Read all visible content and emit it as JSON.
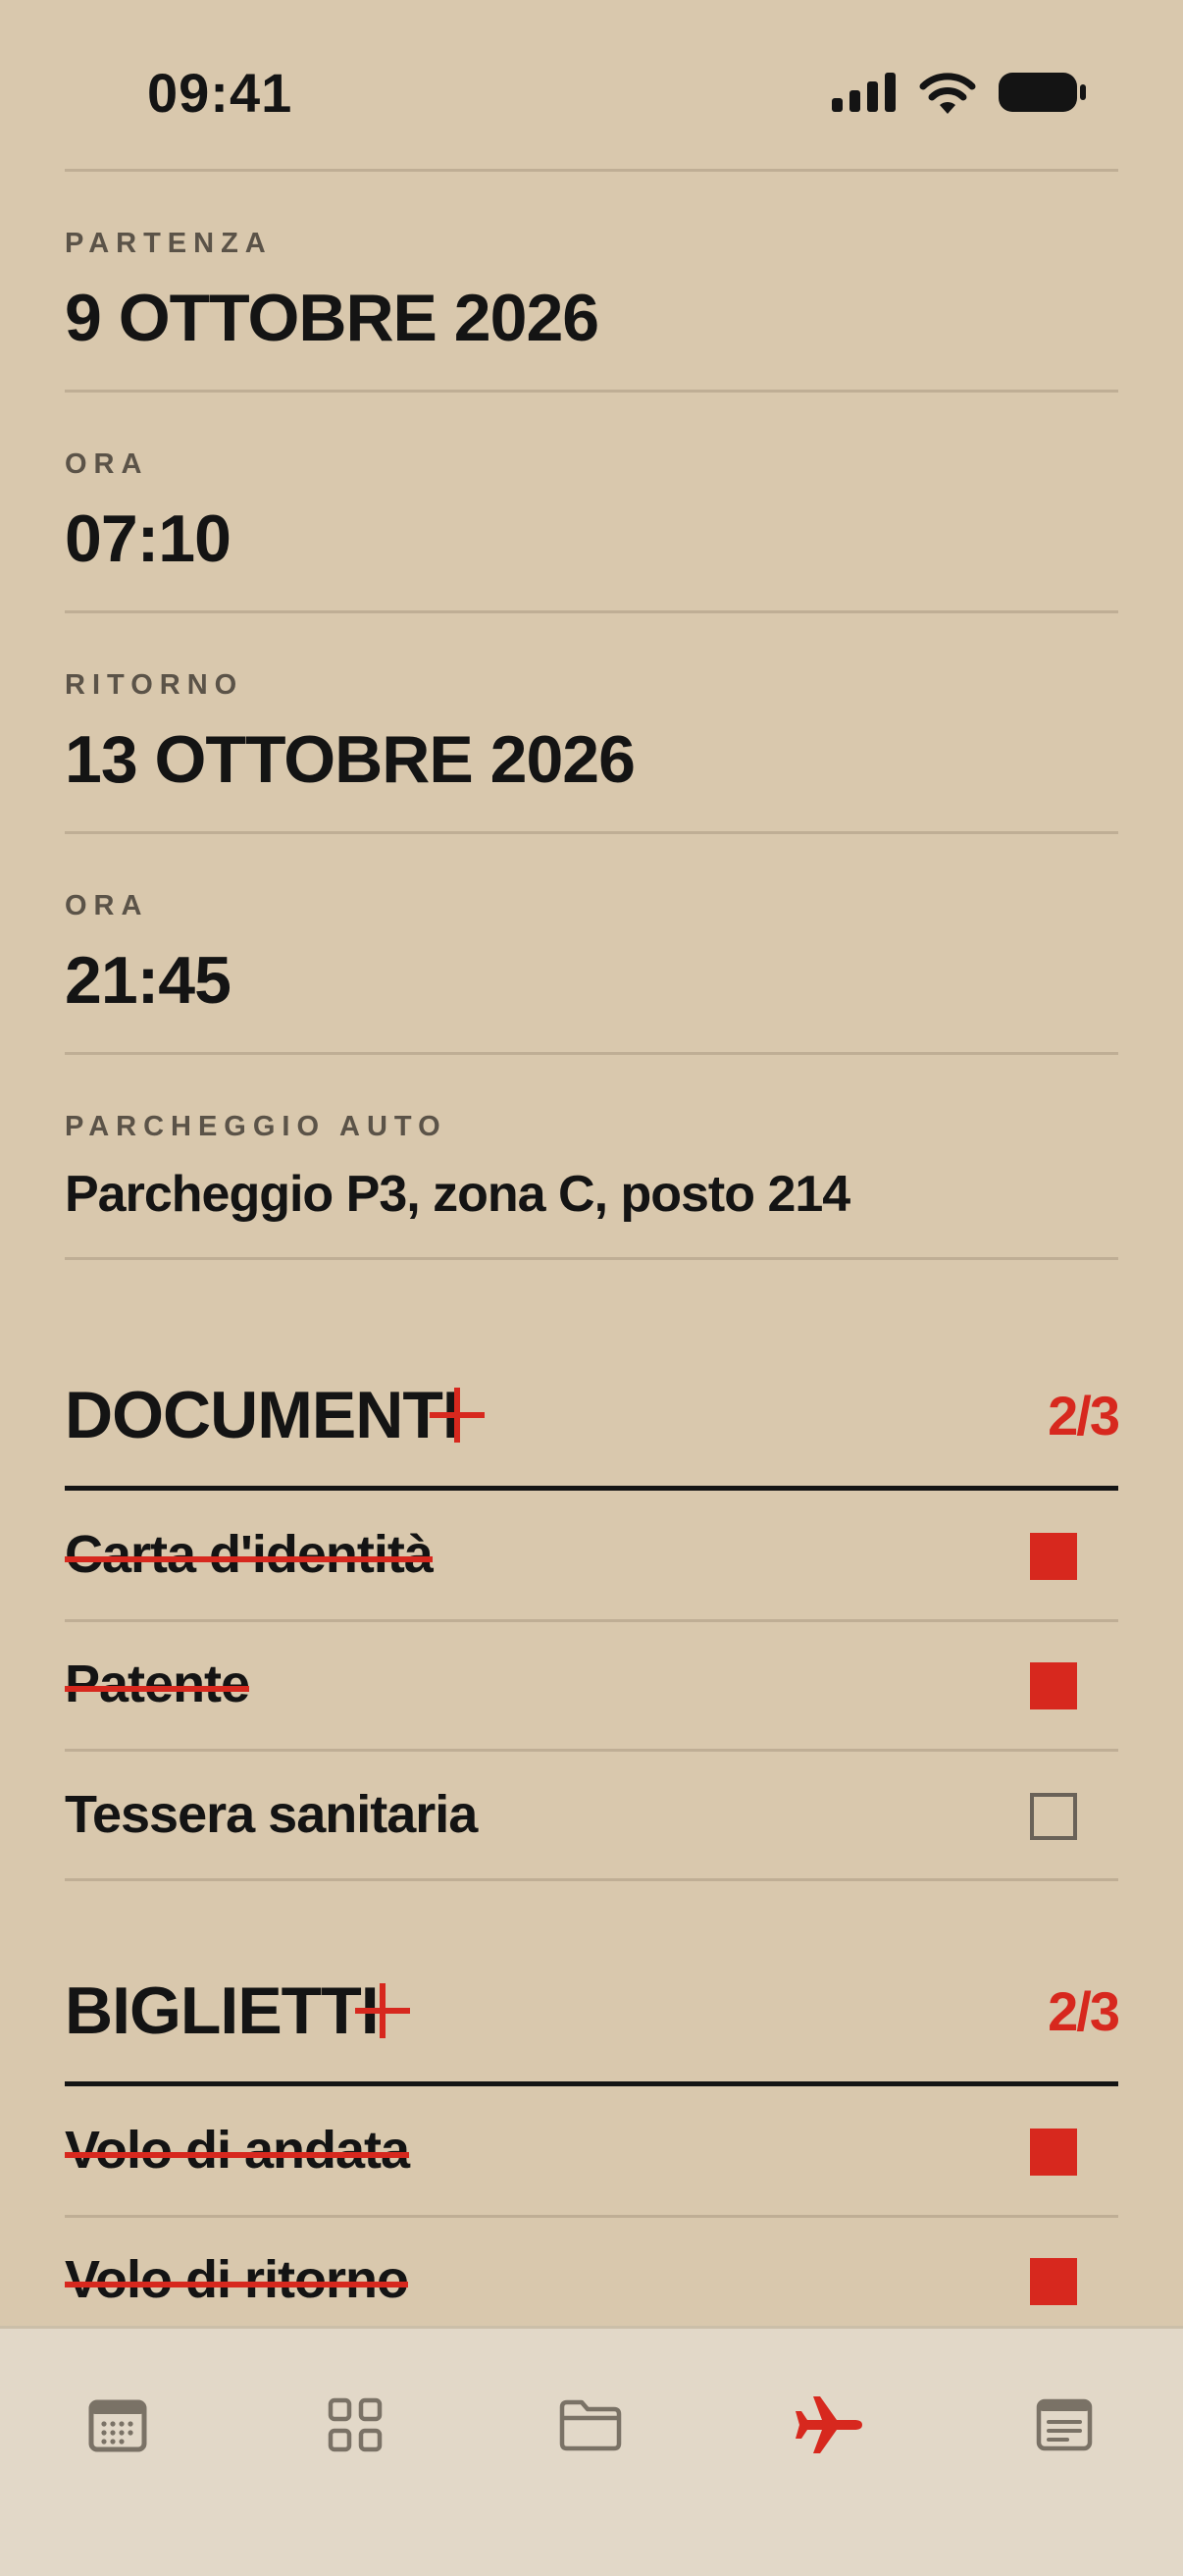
{
  "status_bar": {
    "time": "09:41"
  },
  "fields": [
    {
      "label": "PARTENZA",
      "value": "9 OTTOBRE 2026"
    },
    {
      "label": "ORA",
      "value": "07:10"
    },
    {
      "label": "RITORNO",
      "value": "13 OTTOBRE 2026"
    },
    {
      "label": "ORA",
      "value": "21:45"
    },
    {
      "label": "PARCHEGGIO AUTO",
      "value": "Parcheggio P3, zona C, posto 214"
    }
  ],
  "documents": {
    "title": "DOCUMENTI",
    "count": "2/3",
    "items": [
      {
        "label": "Carta d'identità",
        "checked": true
      },
      {
        "label": "Patente",
        "checked": true
      },
      {
        "label": "Tessera sanitaria",
        "checked": false
      }
    ]
  },
  "tickets": {
    "title": "BIGLIETTI",
    "count": "2/3",
    "items": [
      {
        "label": "Volo di andata",
        "checked": true
      },
      {
        "label": "Volo di ritorno",
        "checked": true
      }
    ]
  },
  "tabbar": {
    "tabs": [
      {
        "icon": "calendar-icon",
        "active": false
      },
      {
        "icon": "grid-icon",
        "active": false
      },
      {
        "icon": "folder-icon",
        "active": false
      },
      {
        "icon": "airplane-icon",
        "active": true
      },
      {
        "icon": "notes-icon",
        "active": false
      }
    ]
  },
  "colors": {
    "background": "#d9c8ad",
    "accent": "#d7281e",
    "text": "#141414",
    "tabbar": "#e2d8c8"
  }
}
